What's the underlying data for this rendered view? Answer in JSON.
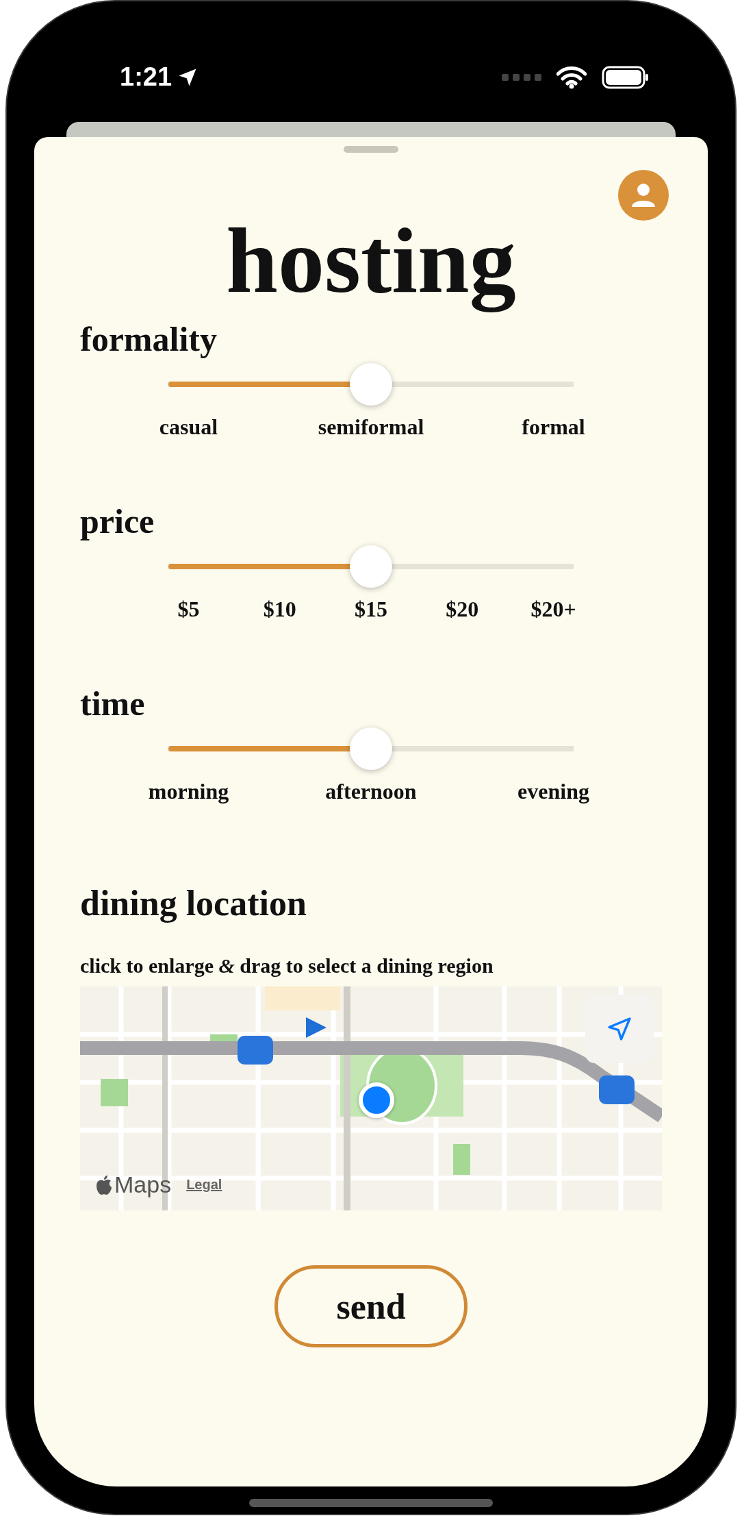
{
  "status_bar": {
    "time": "1:21"
  },
  "title": "hosting",
  "sliders": [
    {
      "label": "formality",
      "level": 0.5,
      "ticks": [
        "casual",
        "semiformal",
        "formal"
      ]
    },
    {
      "label": "price",
      "level": 0.5,
      "ticks": [
        "$5",
        "$10",
        "$15",
        "$20",
        "$20+"
      ]
    },
    {
      "label": "time",
      "level": 0.5,
      "ticks": [
        "morning",
        "afternoon",
        "evening"
      ]
    }
  ],
  "location": {
    "heading": "dining location",
    "hint": "click to enlarge *&* drag to select a dining region",
    "map": {
      "kind": "picture",
      "attribution": "Maps",
      "legal_link": "Legal"
    }
  },
  "send_button": "send"
}
